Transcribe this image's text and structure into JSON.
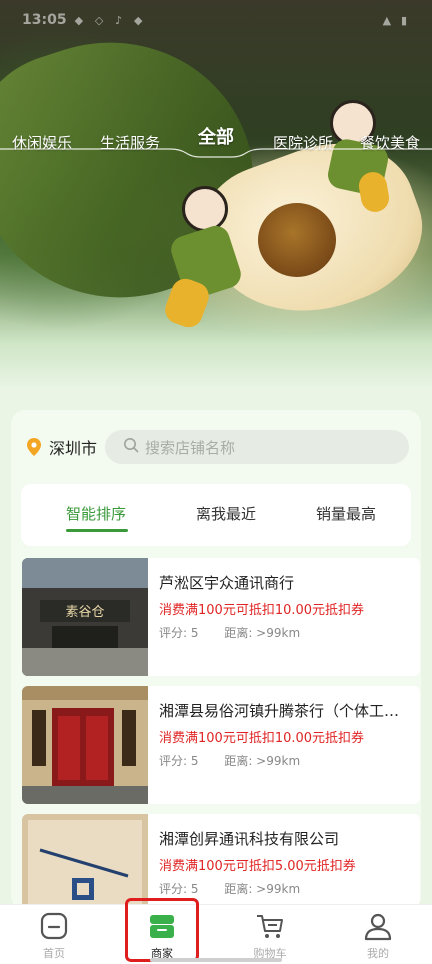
{
  "status_bar": {
    "time": "13:05"
  },
  "category_tabs": [
    {
      "label": "休闲娱乐"
    },
    {
      "label": "生活服务"
    },
    {
      "label": "全部",
      "active": true
    },
    {
      "label": "医院诊所"
    },
    {
      "label": "餐饮美食"
    }
  ],
  "location": {
    "city": "深圳市",
    "icon": "location-pin-icon"
  },
  "search": {
    "placeholder": "搜索店铺名称",
    "icon": "search-icon"
  },
  "sort_tabs": [
    {
      "label": "智能排序",
      "active": true
    },
    {
      "label": "离我最近"
    },
    {
      "label": "销量最高"
    }
  ],
  "stores": [
    {
      "name": "芦淞区宇众通讯商行",
      "promo": "消费满100元可抵扣10.00元抵扣券",
      "rating": "评分: 5",
      "distance": "距离: >99km",
      "sign_text": "素谷仓"
    },
    {
      "name": "湘潭县易俗河镇升腾茶行（个体工商户）",
      "promo": "消费满100元可抵扣10.00元抵扣券",
      "rating": "评分: 5",
      "distance": "距离: >99km",
      "sign_text": ""
    },
    {
      "name": "湘潭创昇通讯科技有限公司",
      "promo": "消费满100元可抵扣5.00元抵扣券",
      "rating": "评分: 5",
      "distance": "距离: >99km",
      "sign_text": ""
    }
  ],
  "bottom_nav": [
    {
      "label": "首页",
      "icon": "home-icon"
    },
    {
      "label": "商家",
      "icon": "store-icon",
      "active": true
    },
    {
      "label": "购物车",
      "icon": "cart-icon"
    },
    {
      "label": "我的",
      "icon": "profile-icon"
    }
  ],
  "colors": {
    "accent_green": "#3a9a3a",
    "promo_red": "#e02424",
    "highlight_red": "#e01d1d"
  }
}
